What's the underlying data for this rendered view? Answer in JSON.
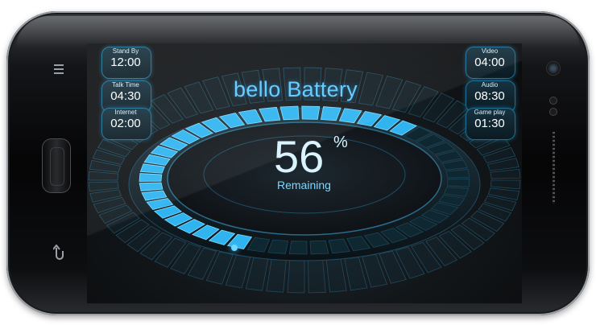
{
  "app": {
    "title": "bello Battery"
  },
  "battery": {
    "percent": "56",
    "percent_sign": "%",
    "remaining_label": "Remaining",
    "level": 0.56
  },
  "stats_left": [
    {
      "label": "Stand By",
      "value": "12:00"
    },
    {
      "label": "Talk Time",
      "value": "04:30"
    },
    {
      "label": "Internet",
      "value": "02:00"
    }
  ],
  "stats_right": [
    {
      "label": "Video",
      "value": "04:00"
    },
    {
      "label": "Audio",
      "value": "08:30"
    },
    {
      "label": "Game play",
      "value": "01:30"
    }
  ],
  "hardware_keys": {
    "menu_icon": "menu-icon",
    "back_icon": "back-icon"
  },
  "colors": {
    "accent": "#2fb4f0",
    "accent_light": "#5ec8ff",
    "background": "#121619"
  }
}
